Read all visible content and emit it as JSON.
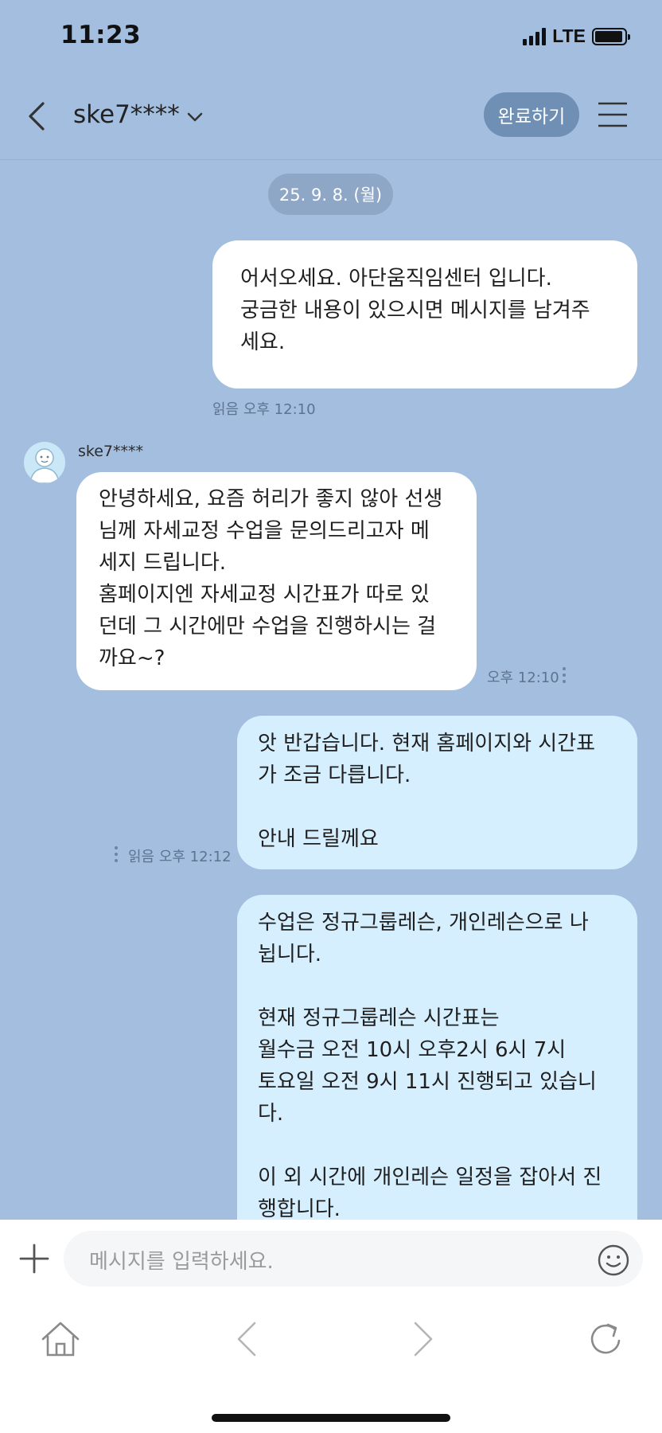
{
  "status_bar": {
    "time": "11:23",
    "network": "LTE"
  },
  "header": {
    "title": "ske7****",
    "done_label": "완료하기"
  },
  "date_chip": "25. 9. 8. (월)",
  "messages": [
    {
      "id": "m1",
      "text": "어서오세요. 아단움직임센터 입니다.\n궁금한 내용이 있으시면 메시지를 남겨주\n세요.",
      "meta": "읽음 오후 12:10"
    },
    {
      "id": "m2",
      "sender": "ske7****",
      "text": "안녕하세요, 요즘 허리가 좋지 않아 선생\n님께 자세교정 수업을 문의드리고자 메\n세지 드립니다.\n홈페이지엔 자세교정 시간표가 따로 있\n던데 그 시간에만 수업을 진행하시는 걸\n까요~?",
      "meta": "오후 12:10"
    },
    {
      "id": "m3",
      "text": "앗 반갑습니다. 현재 홈페이지와 시간표\n가 조금 다릅니다.\n\n안내 드릴께요",
      "meta": "읽음 오후 12:12"
    },
    {
      "id": "m4",
      "text": "수업은 정규그룹레슨, 개인레슨으로 나\n뉩니다.\n\n현재 정규그룹레슨 시간표는\n월수금 오전 10시 오후2시 6시 7시\n토요일 오전 9시 11시 진행되고 있습니\n다.\n\n이 외 시간에 개인레슨 일정을 잡아서 진\n행합니다."
    }
  ],
  "input": {
    "placeholder": "메시지를 입력하세요."
  }
}
